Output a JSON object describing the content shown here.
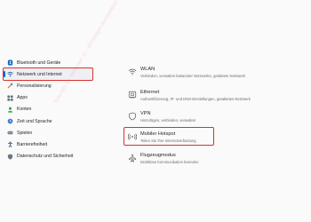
{
  "sidebar": {
    "items": [
      {
        "label": "Bluetooth und Geräte",
        "icon": "bluetooth-icon"
      },
      {
        "label": "Netzwerk und Internet",
        "icon": "network-icon"
      },
      {
        "label": "Personalisierung",
        "icon": "brush-icon"
      },
      {
        "label": "Apps",
        "icon": "apps-icon"
      },
      {
        "label": "Konten",
        "icon": "account-icon"
      },
      {
        "label": "Zeit und Sprache",
        "icon": "clock-icon"
      },
      {
        "label": "Spielen",
        "icon": "gamepad-icon"
      },
      {
        "label": "Barrierefreiheit",
        "icon": "accessibility-icon"
      },
      {
        "label": "Datenschutz und Sicherheit",
        "icon": "shield-icon"
      }
    ]
  },
  "main": {
    "settings": [
      {
        "title": "WLAN",
        "desc": "Verbinden, verwalten bekannter Netzwerke, getaktete Netzwerk",
        "icon": "wifi-icon"
      },
      {
        "title": "Ethernet",
        "desc": "Authentifizierung, IP- und DNS-Einstellungen, getaktetes Netzwerk",
        "icon": "ethernet-icon"
      },
      {
        "title": "VPN",
        "desc": "Hinzufügen, verbinden, verwalten",
        "icon": "vpn-icon"
      },
      {
        "title": "Mobiler Hotspot",
        "desc": "Teilen Sie Ihre Internetverbindung",
        "icon": "hotspot-icon"
      },
      {
        "title": "Flugzeugmodus",
        "desc": "Drahtlose Kommunikation beenden",
        "icon": "airplane-icon"
      }
    ]
  },
  "watermark": {
    "text": "Tutorials für Windows 11 - Einsteiger-Kompetenz.de"
  },
  "colors": {
    "highlight": "#d9312f",
    "accent": "#0a62c9",
    "text": "#1f1f1f",
    "secondary_text": "#6d6d6d"
  }
}
